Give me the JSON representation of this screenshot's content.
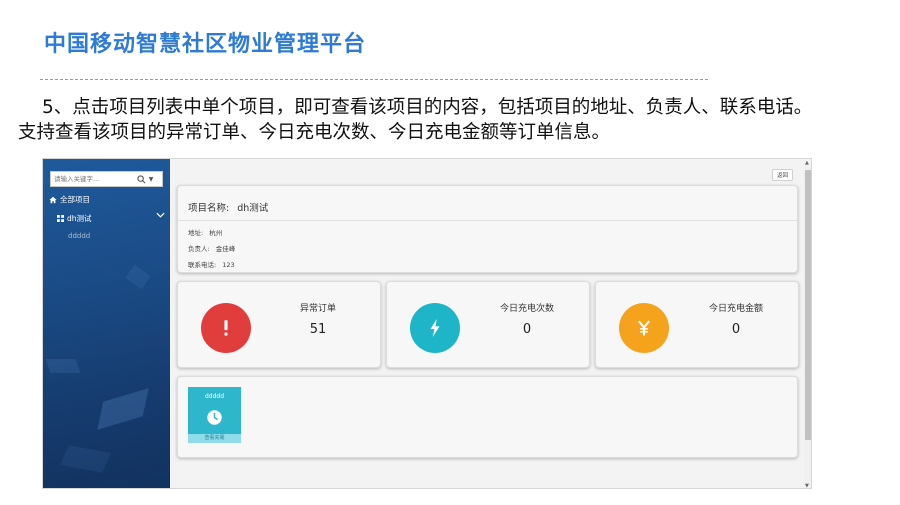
{
  "slide": {
    "title": "中国移动智慧社区物业管理平台",
    "description": "5、点击项目列表中单个项目，即可查看该项目的内容，包括项目的地址、负责人、联系电话。支持查看该项目的异常订单、今日充电次数、今日充电金额等订单信息。",
    "description_line1": "5、点击项目列表中单个项目，即可查看该项目的内容，包括项目的地址、负责人、联系电话。",
    "description_line2": "支持查看该项目的异常订单、今日充电次数、今日充电金额等订单信息。"
  },
  "sidebar": {
    "search_placeholder": "请输入关键字...",
    "all_projects_label": "全部项目",
    "project_label": "dh测试",
    "sub_item_label": "ddddd",
    "icons": {
      "search": "search-icon",
      "dropdown": "caret-down-icon",
      "home": "home-icon",
      "project": "grid-icon",
      "expand": "chevron-down-icon"
    }
  },
  "content": {
    "back_button_label": "返回",
    "project": {
      "name_label": "项目名称:",
      "name_value": "dh测试",
      "address_label": "地址:",
      "address_value": "杭州",
      "manager_label": "负责人:",
      "manager_value": "金佳峰",
      "phone_label": "联系电话:",
      "phone_value": "123"
    },
    "stats": [
      {
        "label": "异常订单",
        "value": "51",
        "icon": "exclamation-icon",
        "color": "#e23d3d"
      },
      {
        "label": "今日充电次数",
        "value": "0",
        "icon": "lightning-icon",
        "color": "#1fb5c9"
      },
      {
        "label": "今日充电金额",
        "value": "0",
        "icon": "yen-icon",
        "color": "#f5a21c"
      }
    ],
    "device_tile": {
      "name": "ddddd",
      "icon": "clock-icon",
      "footer": "查看充電"
    }
  },
  "colors": {
    "title_blue": "#2e7bd6",
    "sidebar_blue": "#1a4a84",
    "tile_cyan": "#2eb6cc"
  }
}
